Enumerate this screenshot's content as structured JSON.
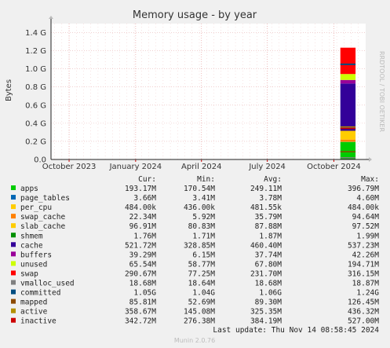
{
  "chart_data": {
    "type": "area",
    "title": "Memory usage - by year",
    "ylabel": "Bytes",
    "ylim": [
      0,
      1.5
    ],
    "y_ticks": [
      "0.0",
      "0.2 G",
      "0.4 G",
      "0.6 G",
      "0.8 G",
      "1.0 G",
      "1.2 G",
      "1.4 G"
    ],
    "y_tick_values": [
      0,
      0.2,
      0.4,
      0.6,
      0.8,
      1.0,
      1.2,
      1.4
    ],
    "x_ticks": [
      "October 2023",
      "January 2024",
      "April 2024",
      "July 2024",
      "October 2024"
    ],
    "x_tick_values": [
      0,
      92,
      183,
      274,
      366
    ],
    "xlim": [
      -25,
      410
    ],
    "grid": true,
    "side_label": "RRDTOOL / TOBI OETIKER",
    "columns": [
      "Cur:",
      "Min:",
      "Avg:",
      "Max:"
    ],
    "series": [
      {
        "name": "apps",
        "color": "#00cc00",
        "cur": "193.17M",
        "min": "170.54M",
        "avg": "249.11M",
        "max": "396.79M"
      },
      {
        "name": "page_tables",
        "color": "#0066b3",
        "cur": "3.66M",
        "min": "3.41M",
        "avg": "3.78M",
        "max": "4.60M"
      },
      {
        "name": "per_cpu",
        "color": "#ffcc00",
        "cur": "484.00k",
        "min": "436.00k",
        "avg": "481.55k",
        "max": "484.00k"
      },
      {
        "name": "swap_cache",
        "color": "#ff8000",
        "cur": "22.34M",
        "min": "5.92M",
        "avg": "35.79M",
        "max": "94.64M"
      },
      {
        "name": "slab_cache",
        "color": "#ffcc00",
        "cur": "96.91M",
        "min": "80.83M",
        "avg": "87.88M",
        "max": "97.52M"
      },
      {
        "name": "shmem",
        "color": "#008f00",
        "cur": "1.76M",
        "min": "1.71M",
        "avg": "1.87M",
        "max": "1.99M"
      },
      {
        "name": "cache",
        "color": "#330099",
        "cur": "521.72M",
        "min": "328.85M",
        "avg": "460.40M",
        "max": "537.23M"
      },
      {
        "name": "buffers",
        "color": "#990099",
        "cur": "39.29M",
        "min": "6.15M",
        "avg": "37.74M",
        "max": "42.26M"
      },
      {
        "name": "unused",
        "color": "#ccff00",
        "cur": "65.54M",
        "min": "58.77M",
        "avg": "67.80M",
        "max": "194.71M"
      },
      {
        "name": "swap",
        "color": "#ff0000",
        "cur": "290.67M",
        "min": "77.25M",
        "avg": "231.70M",
        "max": "316.15M"
      },
      {
        "name": "vmalloc_used",
        "color": "#808080",
        "cur": "18.68M",
        "min": "18.64M",
        "avg": "18.68M",
        "max": "18.87M"
      },
      {
        "name": "committed",
        "color": "#004d80",
        "cur": "1.05G",
        "min": "1.04G",
        "avg": "1.06G",
        "max": "1.24G"
      },
      {
        "name": "mapped",
        "color": "#8c4a00",
        "cur": "85.81M",
        "min": "52.69M",
        "avg": "89.30M",
        "max": "126.45M"
      },
      {
        "name": "active",
        "color": "#b38f00",
        "cur": "358.67M",
        "min": "145.08M",
        "avg": "325.35M",
        "max": "436.32M"
      },
      {
        "name": "inactive",
        "color": "#cc0000",
        "cur": "342.72M",
        "min": "276.38M",
        "avg": "384.19M",
        "max": "527.00M"
      }
    ],
    "last_update": "Last update: Thu Nov 14 08:58:45 2024",
    "footer": "Munin 2.0.76"
  }
}
